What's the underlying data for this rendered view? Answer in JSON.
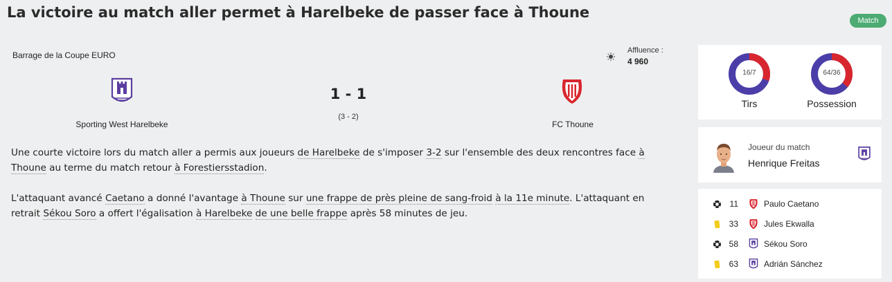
{
  "headline": "La victoire au match aller permet à Harelbeke de passer face à Thoune",
  "badge": "Match",
  "colors": {
    "home": "#5b3fa0",
    "away": "#d8262e",
    "badge": "#4bab72",
    "donut_blue": "#4c3ea8",
    "donut_red": "#d8262e"
  },
  "match": {
    "competition": "Barrage de la Coupe EURO",
    "attendance_label": "Affluence :",
    "attendance": "4 960",
    "weather_icon": "sun-icon",
    "score": "1 - 1",
    "aggregate": "(3 - 2)",
    "home_team": "Sporting West Harelbeke",
    "away_team": "FC Thoune"
  },
  "report": {
    "p1": {
      "t1": "Une courte victoire lors du match aller a permis aux joueurs ",
      "l1": "de Harelbeke",
      "t2": " de s'imposer ",
      "l2": "3-2",
      "t3": " sur l'ensemble des deux rencontres face ",
      "l3": "à Thoune",
      "t4": " au terme du match retour ",
      "l4": "à Forestiersstadion",
      "t5": "."
    },
    "p2": {
      "t1": "L'attaquant avancé ",
      "l1": "Caetano",
      "t2": " a donné l'avantage ",
      "l2": "à Thoune",
      "t3": " sur ",
      "l3": "une frappe de près pleine de sang-froid",
      "t4": " ",
      "l4": "à la 11e minute",
      "t5": ". L'attaquant en retrait ",
      "l5": "Sékou Soro",
      "t6": " a offert l'égalisation ",
      "l6": "à Harelbeke",
      "t7": " ",
      "l7": "de une belle frappe",
      "t8": " après 58 minutes de jeu."
    }
  },
  "stats": [
    {
      "label": "Tirs",
      "value_text": "16/7",
      "home": 16,
      "away": 7
    },
    {
      "label": "Possession",
      "value_text": "64/36",
      "home": 64,
      "away": 36
    }
  ],
  "man_of_match": {
    "label": "Joueur du match",
    "name": "Henrique Freitas"
  },
  "events": [
    {
      "icon": "ball-icon",
      "minute": "11",
      "team": "away",
      "player": "Paulo Caetano"
    },
    {
      "icon": "yellow-card-icon",
      "minute": "33",
      "team": "away",
      "player": "Jules Ekwalla"
    },
    {
      "icon": "ball-icon",
      "minute": "58",
      "team": "home",
      "player": "Sékou Soro"
    },
    {
      "icon": "yellow-card-icon",
      "minute": "63",
      "team": "home",
      "player": "Adrián Sánchez"
    }
  ]
}
